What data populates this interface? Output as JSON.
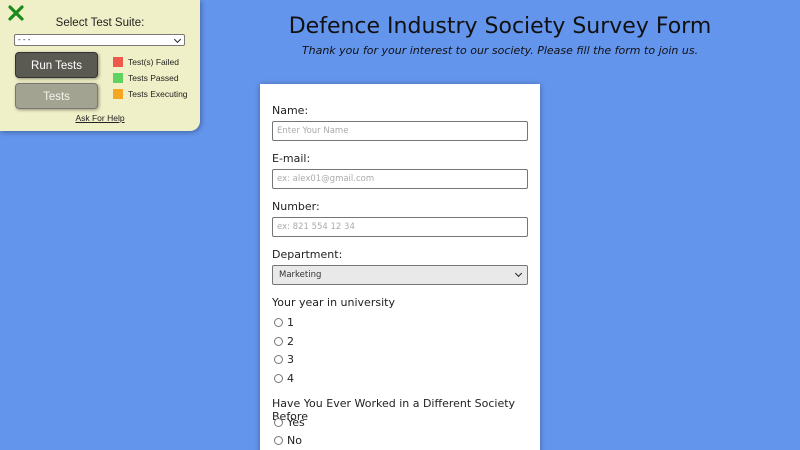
{
  "test_panel": {
    "close_icon": "close-x-icon",
    "select_label": "Select Test Suite:",
    "select_value": "- - -",
    "run_tests_label": "Run Tests",
    "tests_label": "Tests",
    "legend": [
      {
        "label": "Test(s) Failed",
        "color": "#f0574d"
      },
      {
        "label": "Tests Passed",
        "color": "#5fd35f"
      },
      {
        "label": "Tests Executing",
        "color": "#f5a623"
      }
    ],
    "help_link": "Ask For Help"
  },
  "page": {
    "title": "Defence Industry Society Survey Form",
    "subtitle": "Thank you for your interest to our society. Please fill the form to join us."
  },
  "form": {
    "name_label": "Name:",
    "name_placeholder": "Enter Your Name",
    "email_label": "E-mail:",
    "email_placeholder": "ex: alex01@gmail.com",
    "number_label": "Number:",
    "number_placeholder": "ex: 821 554 12 34",
    "department_label": "Department:",
    "department_value": "Marketing",
    "year_question": "Your year in university",
    "year_options": [
      "1",
      "2",
      "3",
      "4"
    ],
    "worked_question": "Have You Ever Worked in a Different Society Before",
    "worked_options": [
      "Yes",
      "No"
    ]
  },
  "colors": {
    "background": "#6495ed",
    "panel": "#f0f0c8",
    "close_icon": "#1a8a1a"
  }
}
